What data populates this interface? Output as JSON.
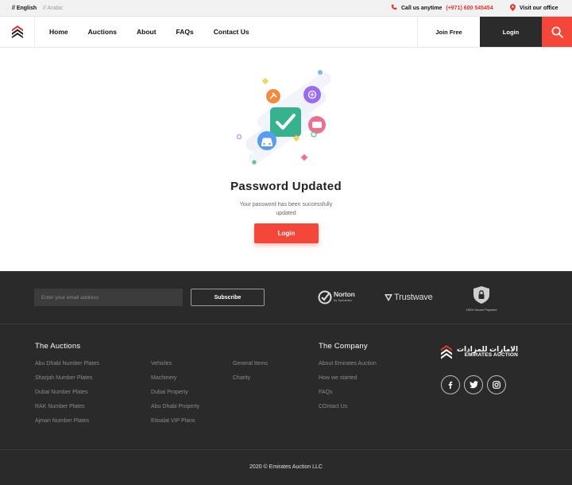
{
  "topbar": {
    "lang_en": "// English",
    "lang_ar": "// Arabic",
    "call_label": "Call us anytime",
    "call_number": "(+971) 600 545454",
    "visit_label": "Visit our office"
  },
  "header": {
    "nav": [
      "Home",
      "Auctions",
      "About",
      "FAQs",
      "Contact Us"
    ],
    "join_label": "Join Free",
    "login_label": "Login",
    "icons": {
      "logo": "chevron-stack-logo",
      "search": "search-icon"
    }
  },
  "main": {
    "title": "Password Updated",
    "message": "Your password has been successfully updated",
    "login_button": "Login"
  },
  "footer": {
    "email_placeholder": "Enter your email address",
    "subscribe_label": "Subscribe",
    "badges": {
      "norton": "Norton",
      "norton_sub": "by Symantec",
      "trustwave": "Trustwave",
      "secure_payment": "100% Secure Payment"
    },
    "auctions_title": "The Auctions",
    "auctions_col1": [
      "Abu Dhabi Number Plates",
      "Sharjah Number Plates",
      "Dubai Number Plates",
      "RAK Number Plates",
      "Ajman Number Plates"
    ],
    "auctions_col2": [
      "Vehicles",
      "Machinery",
      "Dubai Property",
      "Abu Dhabi Property",
      "Etisalat VIP Plans"
    ],
    "auctions_col3": [
      "General Items",
      "Charity"
    ],
    "company_title": "The Company",
    "company_links": [
      "About Emirates Auction",
      "How we started",
      "FAQs",
      "COntact Us"
    ],
    "brand_ar": "الامارات للمزادات",
    "brand_en": "EMIRATES AUCTION",
    "social": [
      "facebook-icon",
      "twitter-icon",
      "instagram-icon"
    ],
    "copyright": "2020 © Emirates Auction LLC"
  },
  "colors": {
    "accent": "#f4473a",
    "dark": "#2a2a2a",
    "nav_dark": "#2b2b2b"
  }
}
